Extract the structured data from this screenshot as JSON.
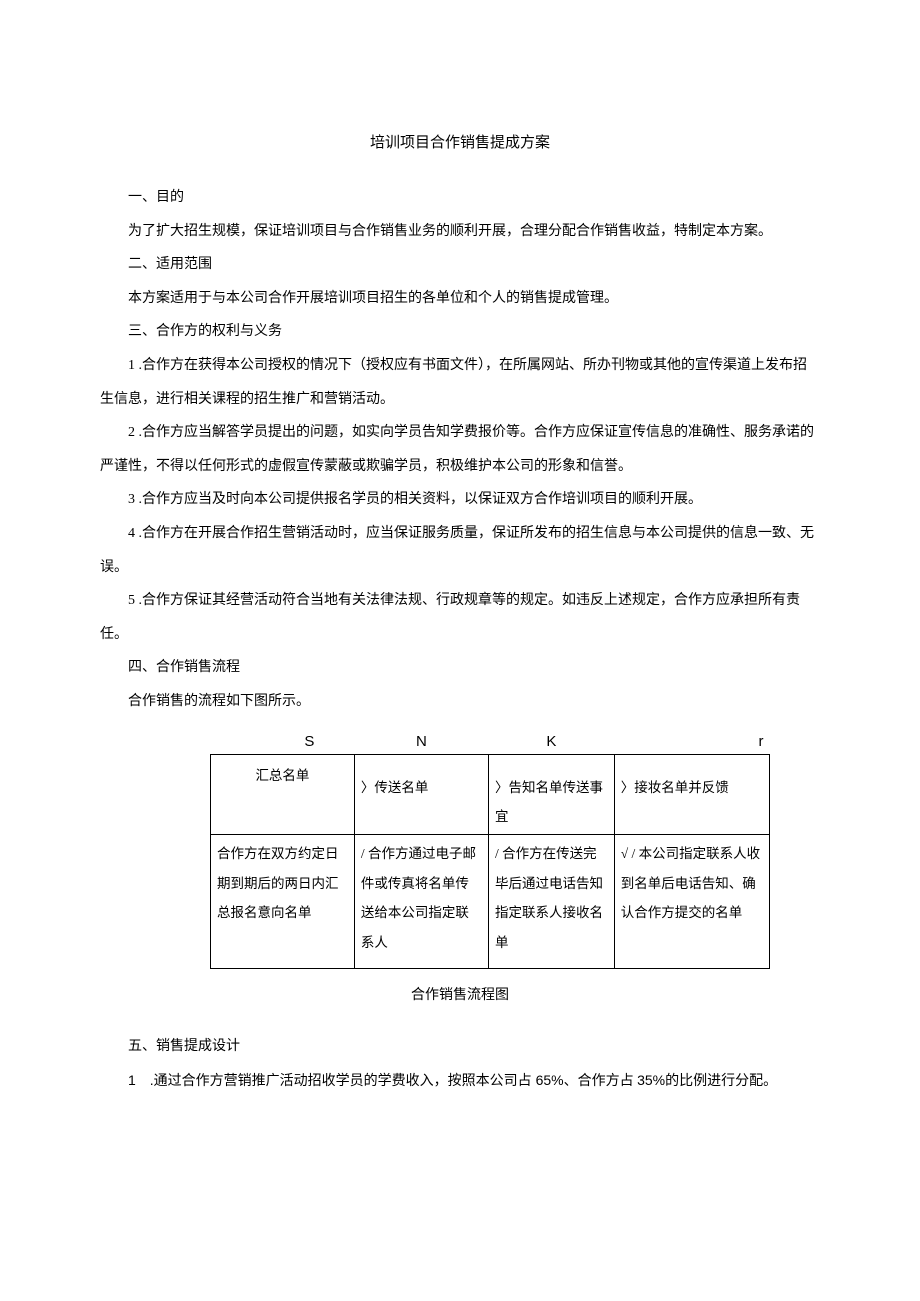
{
  "title": "培训项目合作销售提成方案",
  "s1_h": "一、目的",
  "s1_p1": "为了扩大招生规模，保证培训项目与合作销售业务的顺利开展，合理分配合作销售收益，特制定本方案。",
  "s2_h": "二、适用范围",
  "s2_p1": "本方案适用于与本公司合作开展培训项目招生的各单位和个人的销售提成管理。",
  "s3_h": "三、合作方的权利与义务",
  "s3_i1": "1 .合作方在获得本公司授权的情况下（授权应有书面文件），在所属网站、所办刊物或其他的宣传渠道上发布招生信息，进行相关课程的招生推广和营销活动。",
  "s3_i2": "2 .合作方应当解答学员提出的问题，如实向学员告知学费报价等。合作方应保证宣传信息的准确性、服务承诺的严谨性，不得以任何形式的虚假宣传蒙蔽或欺骗学员，积极维护本公司的形象和信誉。",
  "s3_i3": "3 .合作方应当及时向本公司提供报名学员的相关资料，以保证双方合作培训项目的顺利开展。",
  "s3_i4": "4 .合作方在开展合作招生营销活动时，应当保证服务质量，保证所发布的招生信息与本公司提供的信息一致、无误。",
  "s3_i5": "5 .合作方保证其经营活动符合当地有关法律法规、行政规章等的规定。如违反上述规定，合作方应承担所有责任。",
  "s4_h": "四、合作销售流程",
  "s4_p1": "合作销售的流程如下图所示。",
  "tbl": {
    "hrow": [
      "S",
      "N",
      "K",
      "r"
    ],
    "row1": [
      "汇总名单",
      "〉传送名单",
      "〉告知名单传送事宜",
      "〉接妆名单并反馈"
    ],
    "row2": [
      "合作方在双方约定日期到期后的两日内汇总报名意向名单",
      "/\n合作方通过电子邮件或传真将名单传送给本公司指定联系人",
      "/\n合作方在传送完毕后通过电话告知指定联系人接收名单",
      "√ /\n本公司指定联系人收到名单后电话告知、确认合作方提交的名单"
    ]
  },
  "tbl_caption": "合作销售流程图",
  "s5_h": "五、销售提成设计",
  "s5_i1_a": "1 .通过合作方营销推广活动招收学员的学费收入，按照本公司占 ",
  "s5_i1_b": "65%",
  "s5_i1_c": "、合作方占 ",
  "s5_i1_d": "35%",
  "s5_i1_e": "的比例进行分配。"
}
